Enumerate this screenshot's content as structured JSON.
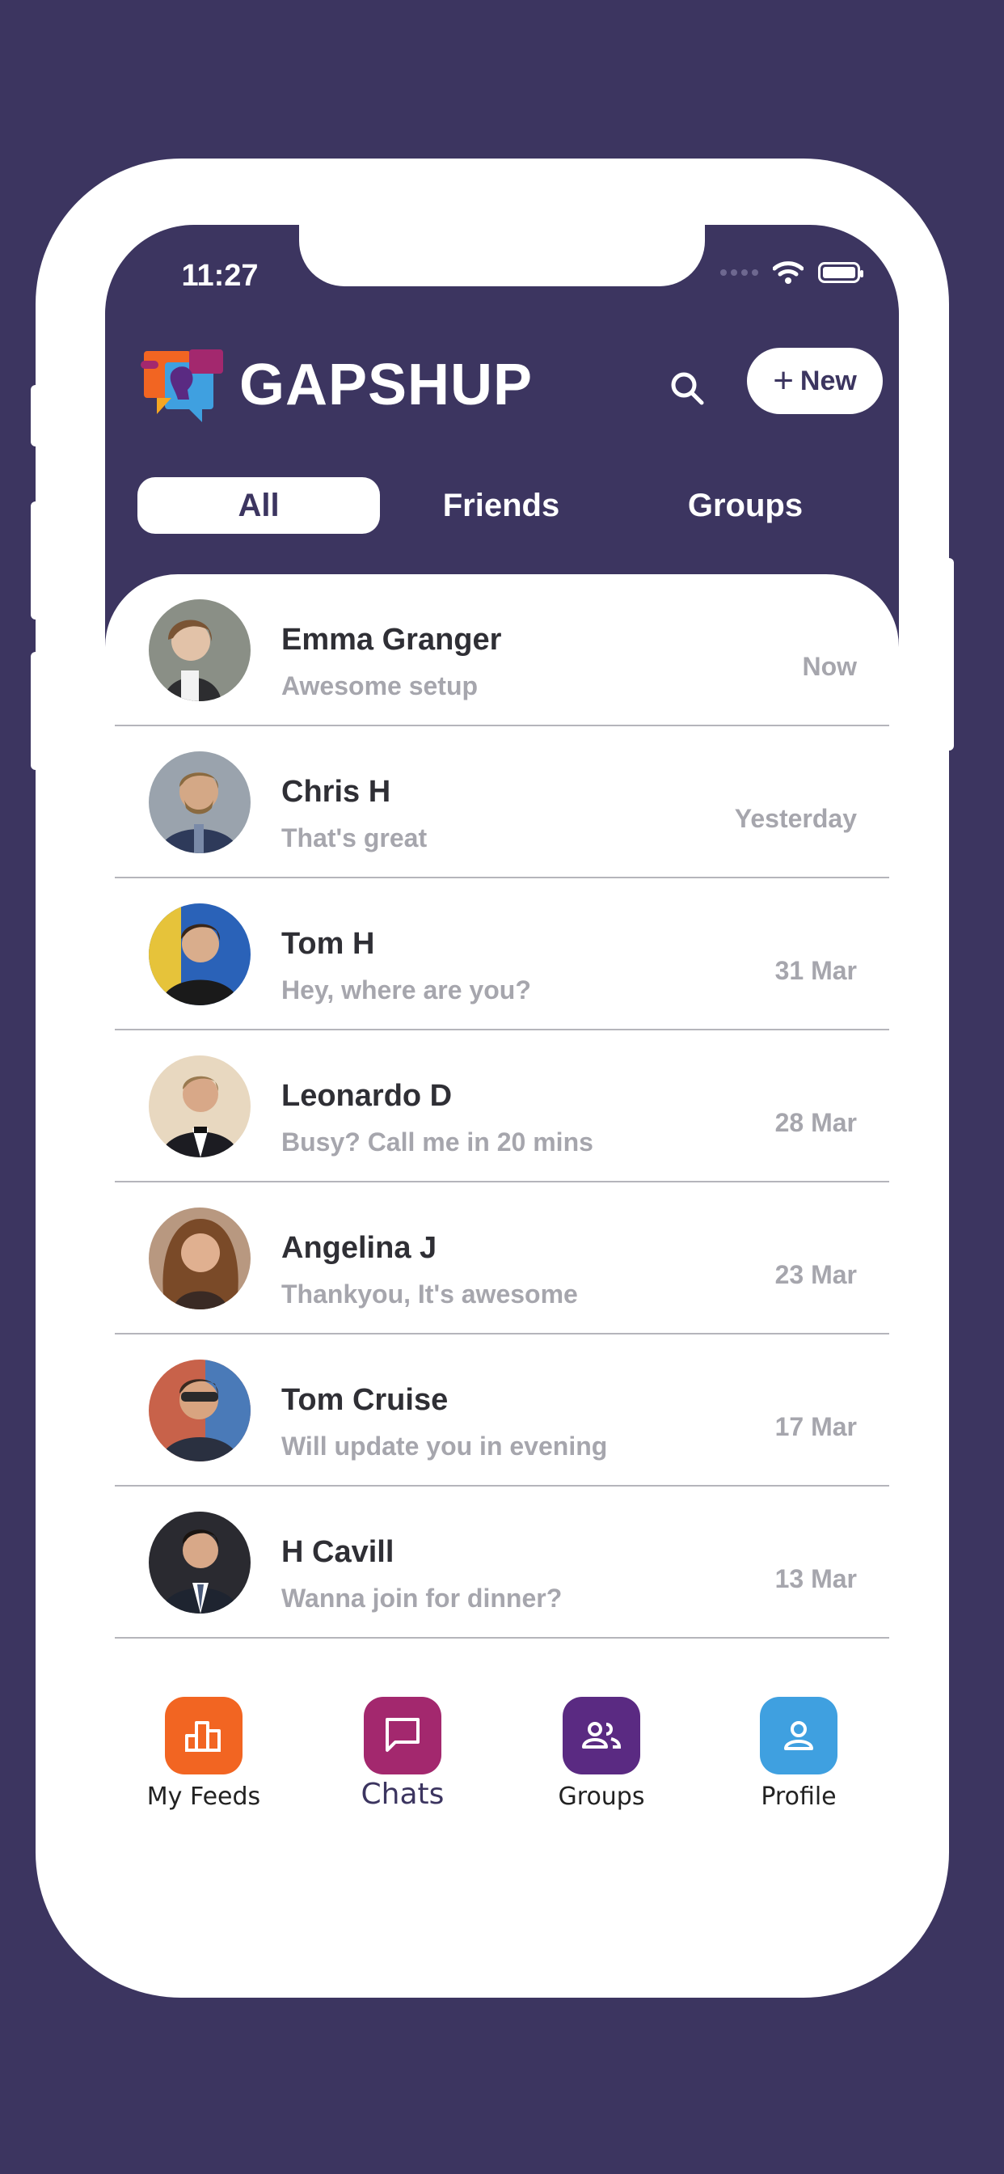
{
  "status_bar": {
    "time": "11:27"
  },
  "header": {
    "logo_text": "GAPSHUP",
    "new_button_label": "New",
    "colors": {
      "background": "#3c3560",
      "accent_orange": "#f26522",
      "accent_magenta": "#a3286e",
      "accent_purple": "#5a2a82",
      "accent_blue": "#3fa0e0"
    }
  },
  "tabs": [
    {
      "label": "All",
      "active": true
    },
    {
      "label": "Friends",
      "active": false
    },
    {
      "label": "Groups",
      "active": false
    }
  ],
  "chats": [
    {
      "name": "Emma Granger",
      "message": "Awesome setup",
      "time": "Now"
    },
    {
      "name": "Chris H",
      "message": "That's great",
      "time": "Yesterday"
    },
    {
      "name": "Tom H",
      "message": "Hey, where are you?",
      "time": "31 Mar"
    },
    {
      "name": "Leonardo D",
      "message": "Busy? Call me in 20 mins",
      "time": "28 Mar"
    },
    {
      "name": "Angelina J",
      "message": "Thankyou, It's awesome",
      "time": "23 Mar"
    },
    {
      "name": "Tom Cruise",
      "message": "Will update you in evening",
      "time": "17 Mar"
    },
    {
      "name": "H Cavill",
      "message": "Wanna join for dinner?",
      "time": "13 Mar"
    }
  ],
  "bottom_nav": [
    {
      "label": "My Feeds",
      "icon": "bar-chart-icon",
      "color": "#f26522",
      "active": false
    },
    {
      "label": "Chats",
      "icon": "chat-bubble-icon",
      "color": "#a3286e",
      "active": true
    },
    {
      "label": "Groups",
      "icon": "group-icon",
      "color": "#5a2a82",
      "active": false
    },
    {
      "label": "Profile",
      "icon": "person-icon",
      "color": "#3fa0e0",
      "active": false
    }
  ]
}
